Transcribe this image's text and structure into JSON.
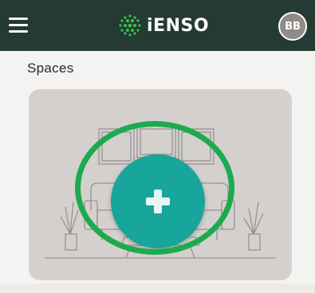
{
  "header": {
    "menu_icon": "hamburger-menu-icon",
    "brand_logo_icon": "dot-cluster-logo-icon",
    "brand_name": "iENSO",
    "avatar_initials": "BB"
  },
  "spaces": {
    "title": "Spaces",
    "add_icon": "plus-icon",
    "illustration": "living-room-line-art",
    "highlight_color": "#1daa4e"
  },
  "colors": {
    "header_bg": "#243a33",
    "brand_accent": "#35c44a",
    "add_button": "#17a59c",
    "card_bg": "#d4d0cd"
  }
}
